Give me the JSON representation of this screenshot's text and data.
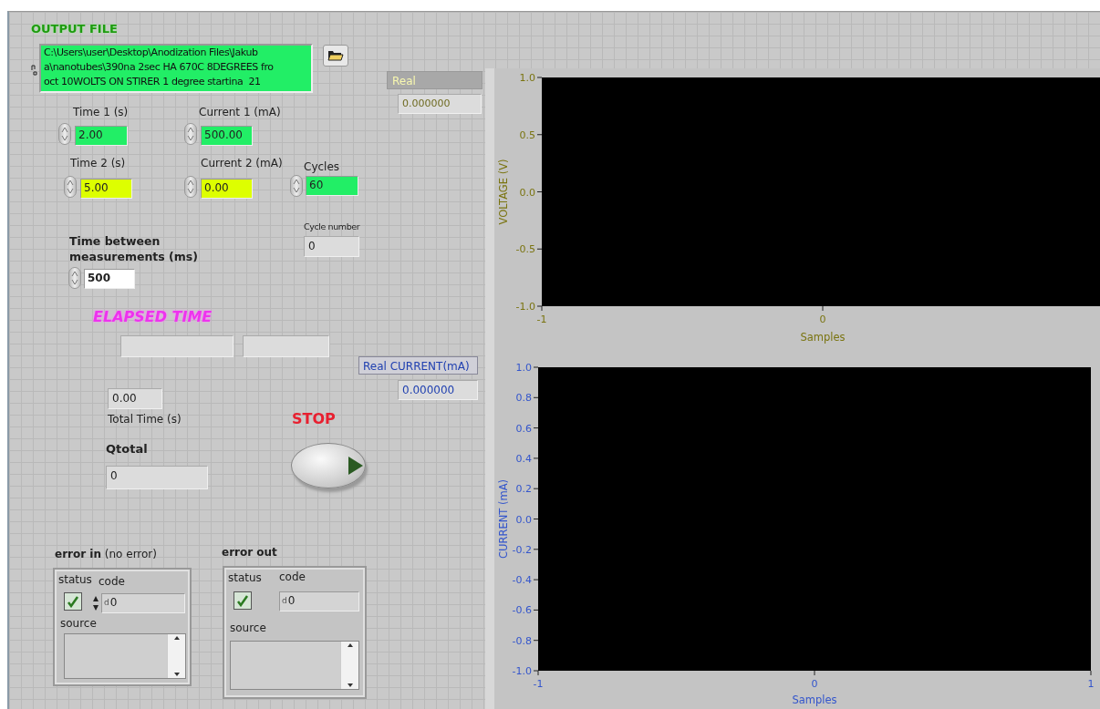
{
  "output_file": {
    "label": "OUTPUT FILE",
    "path": "C:\\Users\\user\\Desktop\\Anodization Files\\Jakub\na\\nanotubes\\390na 2sec HA 670C 8DEGREES fro\noct 10WOLTS ON STIRER 1 degree startina  21"
  },
  "numerics": [
    {
      "label": "Time 1 (s)",
      "value": "2.00",
      "color": "#22ee66"
    },
    {
      "label": "Current 1 (mA)",
      "value": "500.00",
      "color": "#22ee66"
    },
    {
      "label": "Time 2 (s)",
      "value": "5.00",
      "color": "#ddff00"
    },
    {
      "label": "Current 2 (mA)",
      "value": "0.00",
      "color": "#ddff00"
    },
    {
      "label": "Cycles",
      "value": "60",
      "color": "#22ee66"
    },
    {
      "label": "Time between measurements (ms)",
      "value": "500",
      "color": "#ffffff"
    }
  ],
  "indicators": {
    "real": {
      "label": "Real",
      "value": "0.000000"
    },
    "real_current": {
      "label": "Real CURRENT(mA)",
      "value": "0.000000"
    },
    "cycle_number": {
      "label": "Cycle number",
      "value": "0"
    },
    "total_time": {
      "label": "Total Time (s)",
      "value": "0.00"
    },
    "qtotal": {
      "label": "Qtotal",
      "value": "0"
    }
  },
  "elapsed_time": {
    "label": "ELAPSED TIME"
  },
  "stop": {
    "label": "STOP"
  },
  "errors": [
    {
      "label": "**error in** (no error)",
      "status_label": "status",
      "code_label": "code",
      "checked": true,
      "radix": "d",
      "code": "0",
      "source_label": "source"
    },
    {
      "label": "error out",
      "status_label": "status",
      "code_label": "code",
      "checked": true,
      "radix": "d",
      "code": "0",
      "source_label": "source"
    }
  ],
  "graphs": [
    {
      "chart_data": {
        "type": "line",
        "xlabel": "Samples",
        "ylabel": "VOLTAGE (V)",
        "xlim": [
          -1,
          1
        ],
        "ylim": [
          -1,
          1
        ],
        "xticks": [
          {
            "value": -1,
            "label": "-1"
          },
          {
            "value": 0,
            "label": "0"
          }
        ],
        "yticks": [
          {
            "value": 1,
            "label": "1.0"
          },
          {
            "value": 0.5,
            "label": "0.5"
          },
          {
            "value": 0,
            "label": "0.0"
          },
          {
            "value": -0.5,
            "label": "-0.5"
          },
          {
            "value": -1,
            "label": "-1.0"
          }
        ]
      }
    },
    {
      "chart_data": {
        "type": "line",
        "xlabel": "Samples",
        "ylabel": "CURRENT (mA)",
        "xlim": [
          -1,
          1
        ],
        "ylim": [
          -1,
          1
        ],
        "xticks": [
          {
            "value": -1,
            "label": "-1"
          },
          {
            "value": 0,
            "label": "0"
          },
          {
            "value": 1,
            "label": "1"
          }
        ],
        "yticks": [
          {
            "value": 1,
            "label": "1.0"
          },
          {
            "value": 0.8,
            "label": "0.8"
          },
          {
            "value": 0.6,
            "label": "0.6"
          },
          {
            "value": 0.4,
            "label": "0.4"
          },
          {
            "value": 0.2,
            "label": "0.2"
          },
          {
            "value": 0,
            "label": "0.0"
          },
          {
            "value": -0.2,
            "label": "-0.2"
          },
          {
            "value": -0.4,
            "label": "-0.4"
          },
          {
            "value": -0.6,
            "label": "-0.6"
          },
          {
            "value": -0.8,
            "label": "-0.8"
          },
          {
            "value": -1,
            "label": "-1.0"
          }
        ]
      }
    }
  ]
}
